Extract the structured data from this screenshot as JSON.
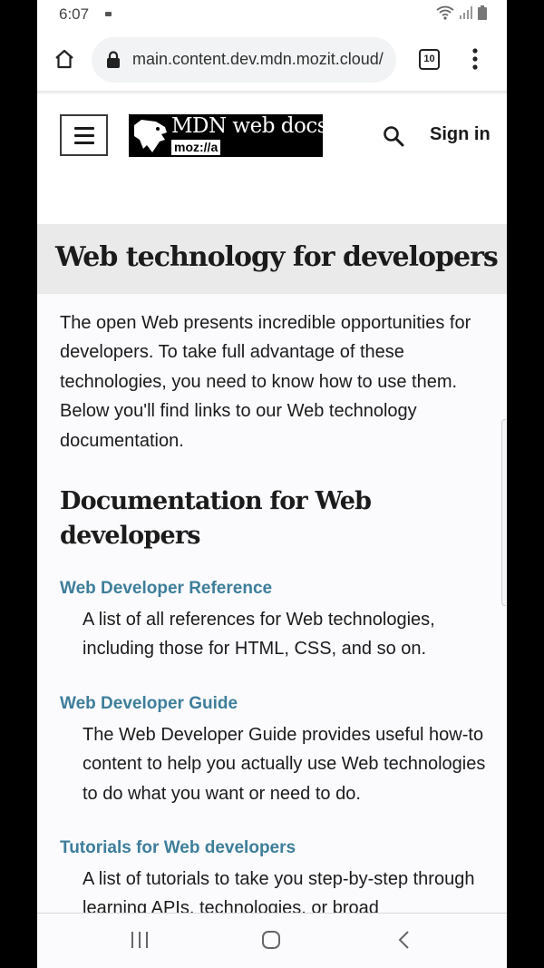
{
  "status_bar": {
    "time": "6:07",
    "icons": [
      "notification-icon",
      "wifi-icon",
      "signal-icon",
      "battery-icon"
    ]
  },
  "browser": {
    "url": "main.content.dev.mdn.mozit.cloud/",
    "tab_count": "10",
    "icons": [
      "home-icon",
      "lock-icon",
      "tabs-icon",
      "more-vertical-icon"
    ]
  },
  "header": {
    "logo_text": "MDN web docs",
    "logo_sub": "moz://a",
    "sign_in": "Sign in",
    "icons": [
      "menu-icon",
      "search-icon"
    ]
  },
  "page": {
    "title": "Web technology for developers",
    "intro": "The open Web presents incredible opportunities for developers. To take full advantage of these technologies, you need to know how to use them. Below you'll find links to our Web technology documentation.",
    "section_heading": "Documentation for Web developers",
    "items": [
      {
        "term": "Web Developer Reference",
        "description": "A list of all references for Web technologies, including those for HTML, CSS, and so on."
      },
      {
        "term": "Web Developer Guide",
        "description": "The Web Developer Guide provides useful how-to content to help you actually use Web technologies to do what you want or need to do."
      },
      {
        "term": "Tutorials for Web developers",
        "description": "A list of tutorials to take you step-by-step through learning APIs, technologies, or broad"
      }
    ]
  },
  "colors": {
    "link": "#3d7e9a",
    "title_band": "#eaeaea",
    "text": "#1b1b1b"
  },
  "nav_bar": {
    "icons": [
      "recent-apps-icon",
      "home-button-icon",
      "back-icon"
    ]
  }
}
